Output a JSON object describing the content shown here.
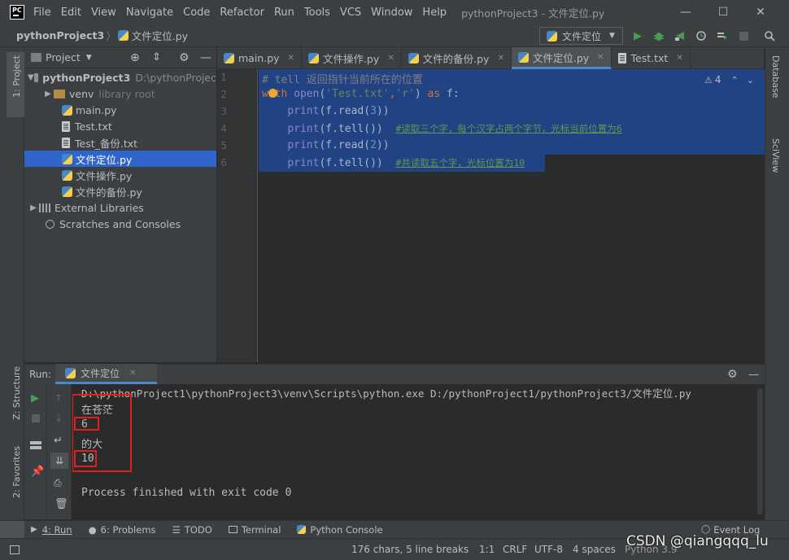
{
  "titlebar": {
    "logo": "PC",
    "menu": [
      "File",
      "Edit",
      "View",
      "Navigate",
      "Code",
      "Refactor",
      "Run",
      "Tools",
      "VCS",
      "Window",
      "Help"
    ],
    "title": "pythonProject3 - 文件定位.py",
    "minimize": "—",
    "maximize": "☐",
    "close": "✕"
  },
  "navbar": {
    "project": "pythonProject3",
    "separator": "〉",
    "file": "文件定位.py",
    "run_config": "文件定位"
  },
  "left_strip": {
    "project_tab": "1: Project",
    "structure_tab": "Z: Structure",
    "favorites_tab": "2: Favorites"
  },
  "right_strip": {
    "database_tab": "Database",
    "sciview_tab": "SciView"
  },
  "project_panel": {
    "title": "Project",
    "root": {
      "name": "pythonProject3",
      "path": "D:\\pythonProjec"
    },
    "items": [
      {
        "name": "venv",
        "suffix": "library root"
      },
      {
        "name": "main.py"
      },
      {
        "name": "Test.txt"
      },
      {
        "name": "Test_备份.txt"
      },
      {
        "name": "文件定位.py"
      },
      {
        "name": "文件操作.py"
      },
      {
        "name": "文件的备份.py"
      }
    ],
    "external_libraries": "External Libraries",
    "scratches": "Scratches and Consoles"
  },
  "editor": {
    "tabs": [
      {
        "label": "main.py"
      },
      {
        "label": "文件操作.py"
      },
      {
        "label": "文件的备份.py"
      },
      {
        "label": "文件定位.py",
        "active": true
      },
      {
        "label": "Test.txt"
      }
    ],
    "inspection_count": "4",
    "line_numbers": [
      "1",
      "2",
      "3",
      "4",
      "5",
      "6"
    ],
    "lines": {
      "l1": "# tell 返回指针当前所在的位置",
      "l2_kw1": "with",
      "l2_fn": "open",
      "l2_p1": "(",
      "l2_s1": "'Test.txt'",
      "l2_c": ",",
      "l2_s2": "'r'",
      "l2_p2": ")",
      "l2_kw2": "as",
      "l2_rest": "f:",
      "l3_fn": "print",
      "l3_a": "(f.read(",
      "l3_n": "3",
      "l3_b": "))",
      "l4_fn": "print",
      "l4_a": "(f.tell())",
      "l4_c": "#读取三个字，每个汉字占两个字节，光标当前位置为6",
      "l5_fn": "print",
      "l5_a": "(f.read(",
      "l5_n": "2",
      "l5_b": "))",
      "l6_fn": "print",
      "l6_a": "(f.tell())",
      "l6_c": "#共读取五个字，光标位置为10"
    }
  },
  "run_panel": {
    "label": "Run:",
    "tab": "文件定位",
    "command": "D:\\pythonProject1\\pythonProject3\\venv\\Scripts\\python.exe D:/pythonProject1/pythonProject3/文件定位.py",
    "output": [
      "在苍茫",
      "6",
      "的大",
      "10"
    ],
    "exit": "Process finished with exit code 0"
  },
  "bottom_tabs": {
    "run": "4: Run",
    "problems": "6: Problems",
    "todo": "TODO",
    "terminal": "Terminal",
    "python_console": "Python Console",
    "event_log": "Event Log"
  },
  "statusbar": {
    "chars": "176 chars, 5 line breaks",
    "position": "1:1",
    "line_sep": "CRLF",
    "encoding": "UTF-8",
    "indent": "4 spaces",
    "interpreter": "Python 3.9"
  },
  "watermark": "CSDN @qiangqqq_lu",
  "colors": {
    "accent": "#4a88c7",
    "highlight_box": "#e02020",
    "selection": "#214283"
  }
}
